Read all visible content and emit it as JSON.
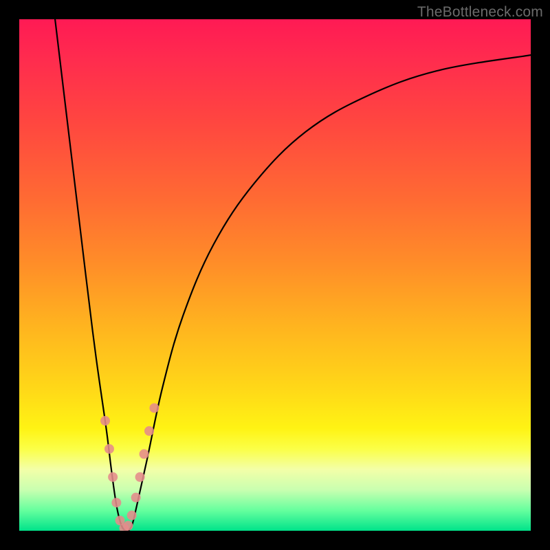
{
  "watermark": "TheBottleneck.com",
  "chart_data": {
    "type": "line",
    "title": "",
    "xlabel": "",
    "ylabel": "",
    "xlim": [
      0,
      100
    ],
    "ylim": [
      0,
      100
    ],
    "series": [
      {
        "name": "bottleneck-curve",
        "x": [
          7,
          10,
          13,
          15,
          17,
          18,
          19,
          20,
          21,
          22,
          23,
          25,
          28,
          32,
          38,
          46,
          56,
          68,
          82,
          100
        ],
        "values": [
          100,
          75,
          50,
          34,
          20,
          12,
          5,
          1,
          0,
          1,
          5,
          14,
          28,
          42,
          56,
          68,
          78,
          85,
          90,
          93
        ]
      }
    ],
    "markers": {
      "name": "highlighted-points",
      "x": [
        16.8,
        17.6,
        18.3,
        19.0,
        19.7,
        20.5,
        21.3,
        22.0,
        22.8,
        23.6,
        24.4,
        25.4,
        26.4
      ],
      "values": [
        21.5,
        16.0,
        10.5,
        5.5,
        2.0,
        0.5,
        1.0,
        3.0,
        6.5,
        10.5,
        15.0,
        19.5,
        24.0
      ]
    }
  }
}
